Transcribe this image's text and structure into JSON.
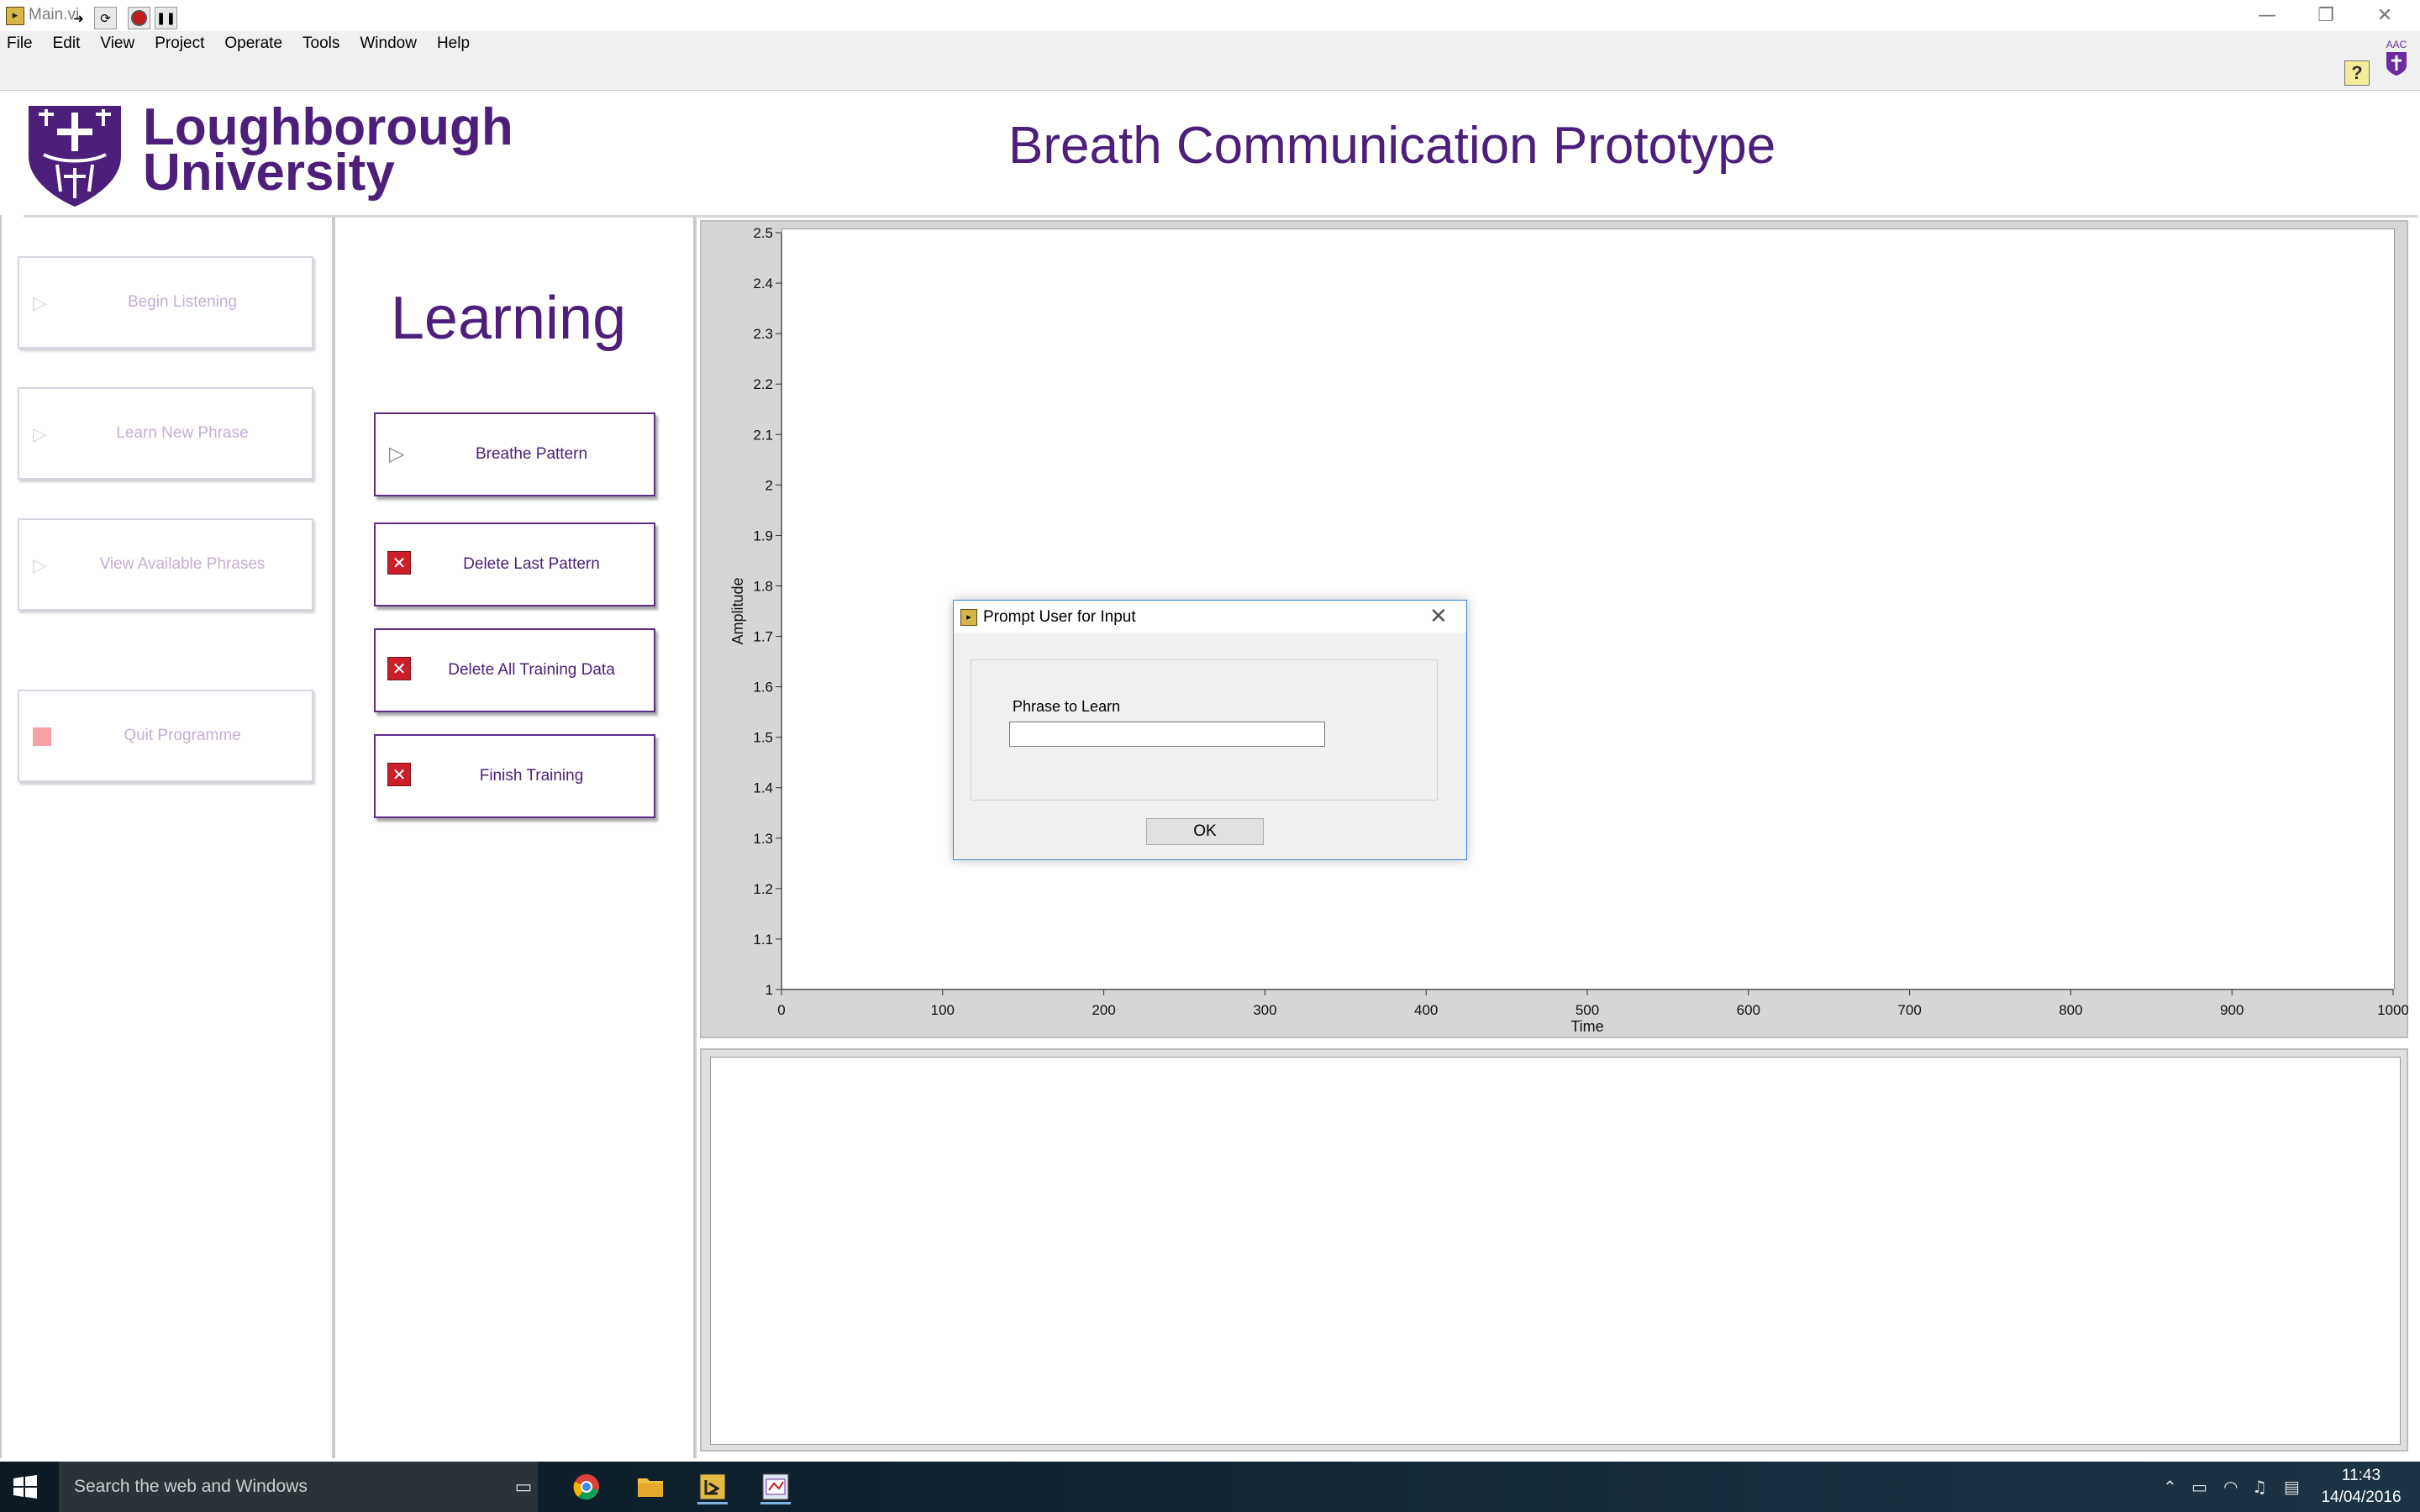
{
  "window": {
    "title": "Main.vi",
    "minimize_glyph": "—",
    "restore_glyph": "❐",
    "close_glyph": "✕"
  },
  "menu": [
    "File",
    "Edit",
    "View",
    "Project",
    "Operate",
    "Tools",
    "Window",
    "Help"
  ],
  "toolbar": {
    "run_icon": "run-arrow-icon",
    "run_continuous_icon": "run-continuously-icon",
    "abort_icon": "abort-execution-icon",
    "pause_icon": "pause-icon",
    "help_label": "?",
    "badge_text": "AAC"
  },
  "header": {
    "logo_line1": "Loughborough",
    "logo_line2": "University",
    "title": "Breath Communication Prototype"
  },
  "sidebar": {
    "buttons": [
      {
        "label": "Begin Listening",
        "icon": "play-icon"
      },
      {
        "label": "Learn New Phrase",
        "icon": "play-icon"
      },
      {
        "label": "View Available Phrases",
        "icon": "play-icon"
      },
      {
        "label": "Quit Programme",
        "icon": "stop-icon"
      }
    ]
  },
  "learning": {
    "title": "Learning",
    "buttons": [
      {
        "label": "Breathe Pattern",
        "icon": "play-icon"
      },
      {
        "label": "Delete Last Pattern",
        "icon": "red-x-icon"
      },
      {
        "label": "Delete All Training Data",
        "icon": "red-x-icon"
      },
      {
        "label": "Finish Training",
        "icon": "red-x-icon"
      }
    ]
  },
  "chart_data": {
    "type": "line",
    "title": "",
    "xlabel": "Time",
    "ylabel": "Amplitude",
    "xlim": [
      0,
      1000
    ],
    "ylim": [
      1,
      2.5
    ],
    "x_ticks": [
      "0",
      "100",
      "200",
      "300",
      "400",
      "500",
      "600",
      "700",
      "800",
      "900",
      "1000"
    ],
    "y_ticks": [
      "1",
      "1.1",
      "1.2",
      "1.3",
      "1.4",
      "1.5",
      "1.6",
      "1.7",
      "1.8",
      "1.9",
      "2",
      "2.1",
      "2.2",
      "2.3",
      "2.4",
      "2.5"
    ],
    "series": [],
    "grid": false
  },
  "dialog": {
    "title": "Prompt User for Input",
    "field_label": "Phrase to Learn",
    "field_value": "",
    "ok_label": "OK",
    "close_glyph": "✕"
  },
  "taskbar": {
    "search_placeholder": "Search the web and Windows",
    "apps": [
      "task-view-icon",
      "chrome-icon",
      "file-explorer-icon",
      "labview-icon",
      "labview-front-panel-icon"
    ],
    "time": "11:43",
    "date": "14/04/2016"
  },
  "colors": {
    "brand_purple": "#4b1f7a",
    "disabled_label": "#c4aed6",
    "delete_red": "#cc1f2a"
  }
}
